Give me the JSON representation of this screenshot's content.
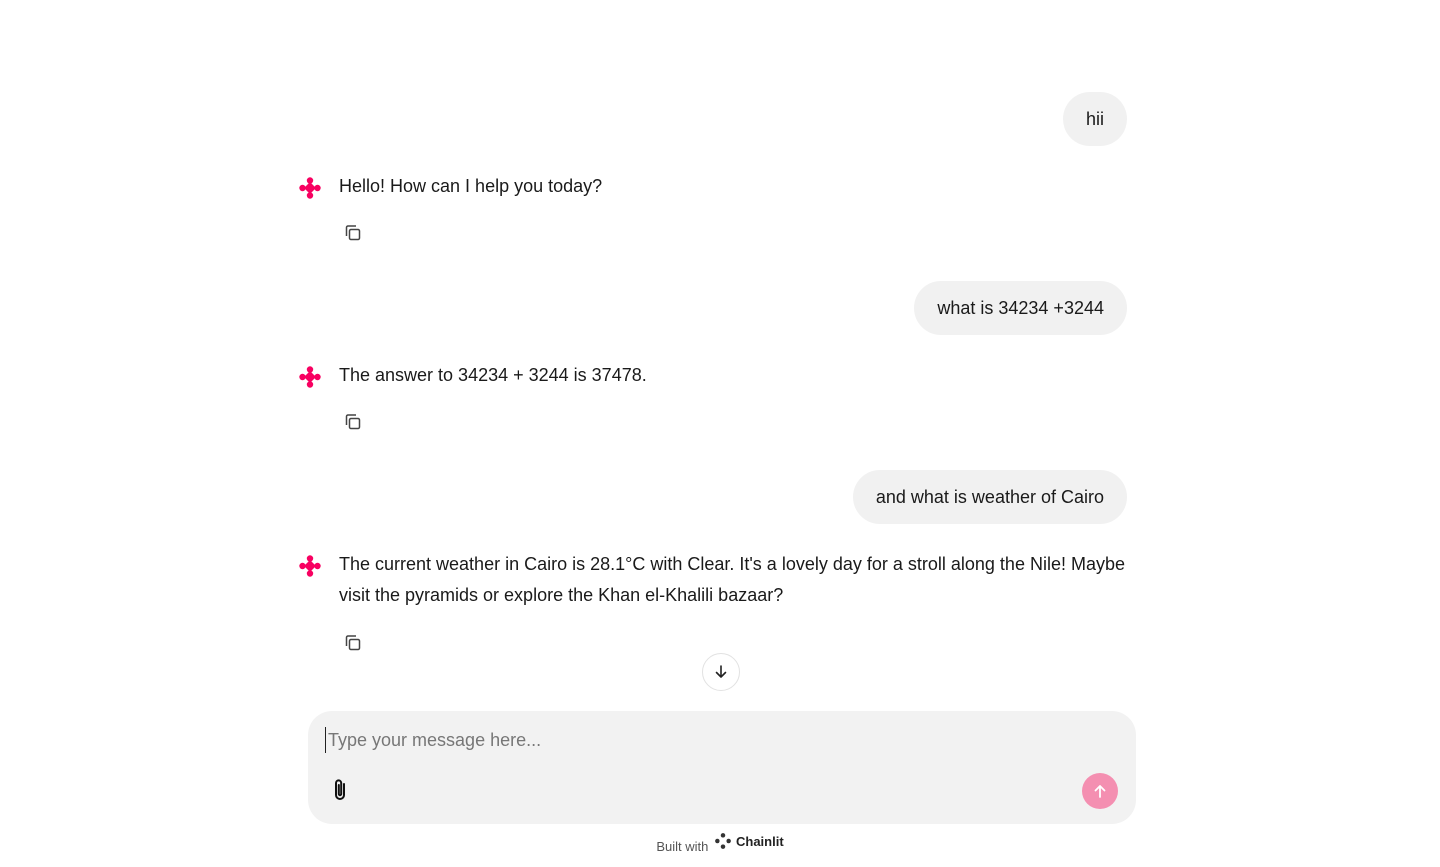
{
  "conversation": [
    {
      "role": "user",
      "text": "hii"
    },
    {
      "role": "assistant",
      "text": "Hello! How can I help you today?"
    },
    {
      "role": "user",
      "text": "what is 34234 +3244"
    },
    {
      "role": "assistant",
      "text": "The answer to 34234 + 3244 is 37478."
    },
    {
      "role": "user",
      "text": "and what is weather of Cairo"
    },
    {
      "role": "assistant",
      "text": "The current weather in Cairo is 28.1°C with Clear. It's a lovely day for a stroll along the Nile! Maybe visit the pyramids or explore the Khan el-Khalili bazaar?"
    }
  ],
  "composer": {
    "placeholder": "Type your message here...",
    "value": ""
  },
  "footer": {
    "built_with": "Built with",
    "brand": "Chainlit"
  },
  "icons": {
    "avatar": "chainlit-logo-icon",
    "copy": "copy-icon",
    "scroll": "arrow-down-icon",
    "attach": "paperclip-icon",
    "send": "arrow-up-icon"
  },
  "colors": {
    "accent": "#f80061",
    "send_button": "#f48fb1",
    "bubble": "#f1f1f1",
    "composer": "#f2f2f2"
  }
}
